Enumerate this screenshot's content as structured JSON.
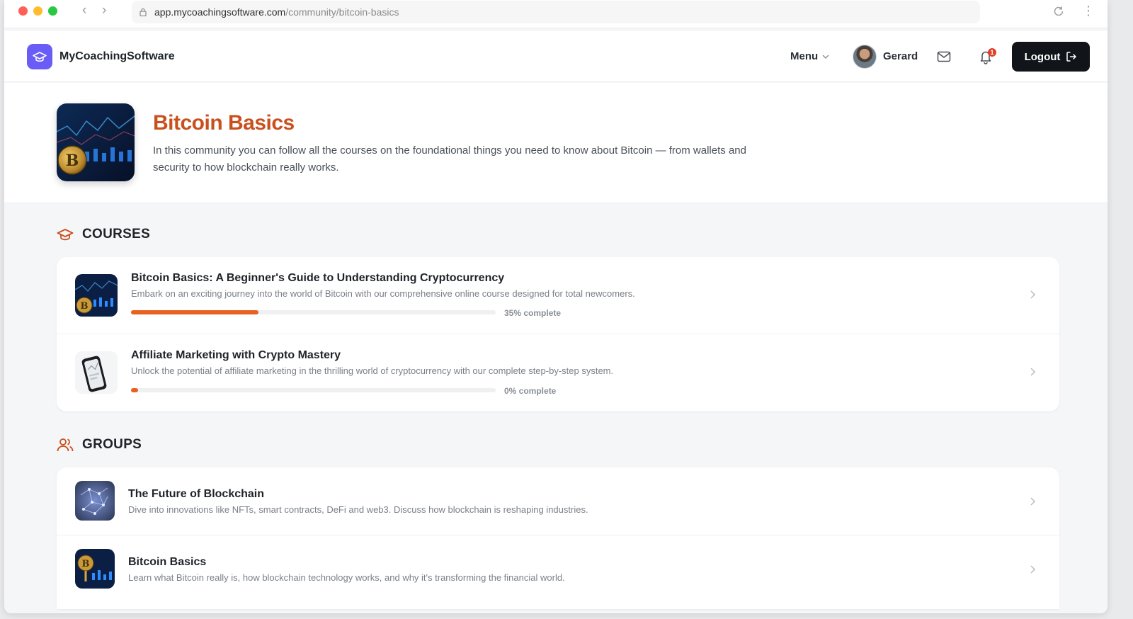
{
  "browser": {
    "url_host": "app.mycoachingsoftware.com",
    "url_path": "/community/bitcoin-basics"
  },
  "header": {
    "brand": "MyCoachingSoftware",
    "menu_label": "Menu",
    "user_name": "Gerard",
    "notification_count": "1",
    "logout_label": "Logout"
  },
  "hero": {
    "title": "Bitcoin Basics",
    "description": "In this community you can follow all the courses on the foundational things you need to know about Bitcoin — from wallets and security to how blockchain really works."
  },
  "courses": {
    "heading": "COURSES",
    "items": [
      {
        "title": "Bitcoin Basics: A Beginner's Guide to Understanding Cryptocurrency",
        "description": "Embark on an exciting journey into the world of Bitcoin with our comprehensive online course designed for total newcomers.",
        "progress_text": "35% complete",
        "progress": 0.35
      },
      {
        "title": "Affiliate Marketing with Crypto Mastery",
        "description": "Unlock the potential of affiliate marketing in the thrilling world of cryptocurrency with our complete step-by-step system.",
        "progress_text": "0% complete",
        "progress": 0.0
      }
    ]
  },
  "groups": {
    "heading": "GROUPS",
    "items": [
      {
        "title": "The Future of Blockchain",
        "description": "Dive into innovations like NFTs, smart contracts, DeFi and web3. Discuss how blockchain is reshaping industries."
      },
      {
        "title": "Bitcoin Basics",
        "description": "Learn what Bitcoin really is, how blockchain technology works, and why it's transforming the financial world."
      }
    ]
  },
  "colors": {
    "accent": "#c9501c",
    "progress": "#e8611e",
    "logo": "#6a5cf6"
  }
}
